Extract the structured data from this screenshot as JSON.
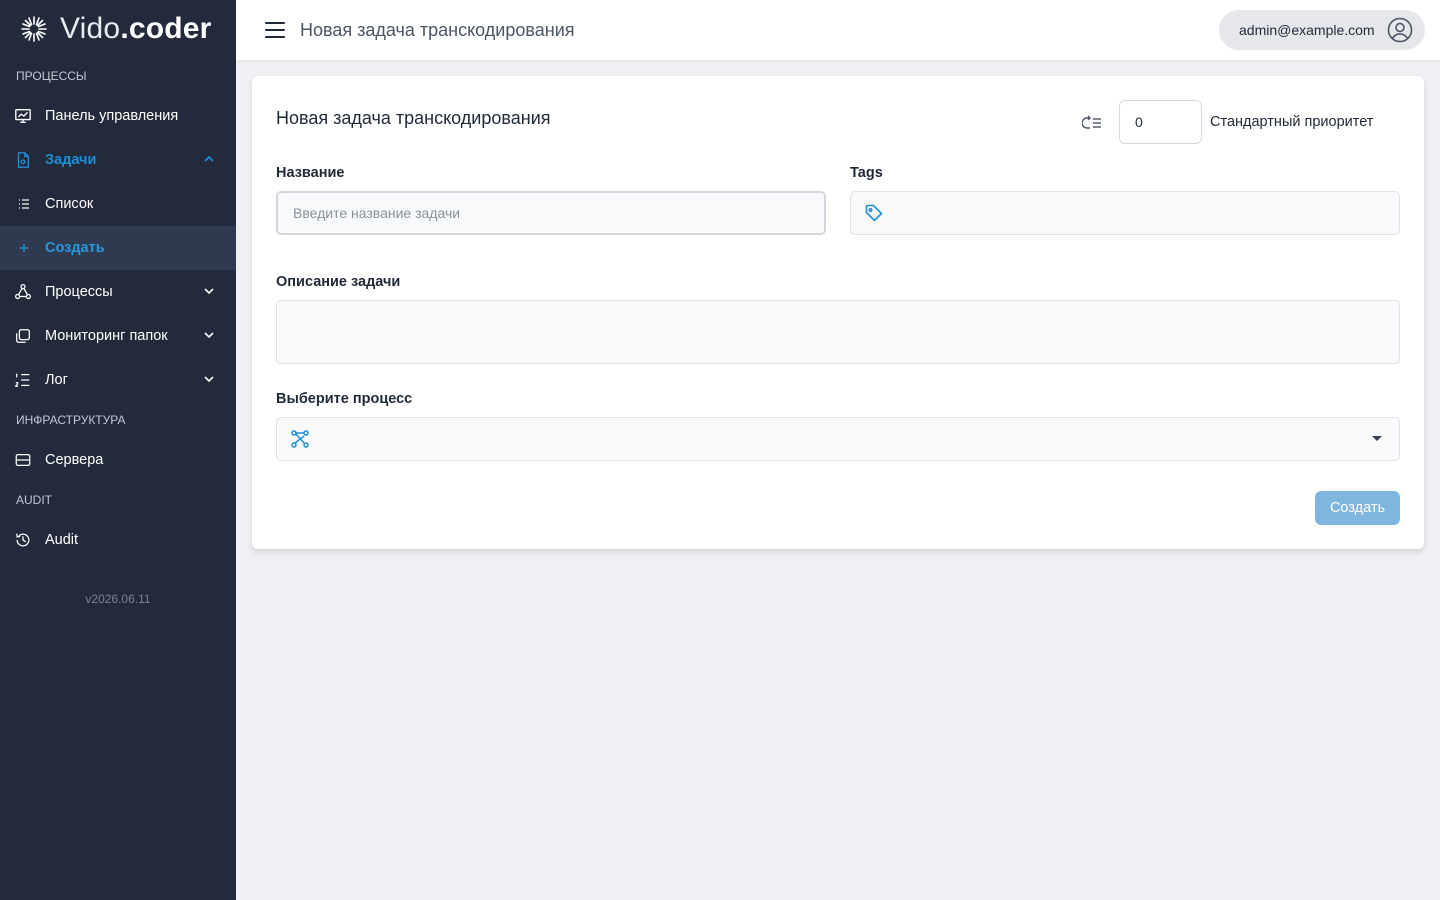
{
  "brand": {
    "light": "Vido",
    "bold": ".coder"
  },
  "sidebar": {
    "sections": {
      "processes": "ПРОЦЕССЫ",
      "infrastructure": "ИНФРАСТРУКТУРА",
      "audit": "AUDIT"
    },
    "items": {
      "dashboard": "Панель управления",
      "tasks": "Задачи",
      "list": "Список",
      "create": "Создать",
      "processes": "Процессы",
      "folder_monitoring": "Мониторинг папок",
      "log": "Лог",
      "servers": "Сервера",
      "audit": "Audit"
    },
    "version": "v2026.06.11"
  },
  "topbar": {
    "title": "Новая задача транскодирования",
    "user": "admin@example.com"
  },
  "form": {
    "title": "Новая задача транскодирования",
    "priority_value": "0",
    "priority_label": "Стандартный приоритет",
    "name_label": "Название",
    "name_placeholder": "Введите название задачи",
    "tags_label": "Tags",
    "description_label": "Описание задачи",
    "process_label": "Выберите процесс",
    "submit_label": "Создать"
  },
  "colors": {
    "sidebar_bg": "#232a3b",
    "accent": "#1f8fd6",
    "button_disabled": "#7fb6dd",
    "page_bg": "#eff0f4"
  }
}
